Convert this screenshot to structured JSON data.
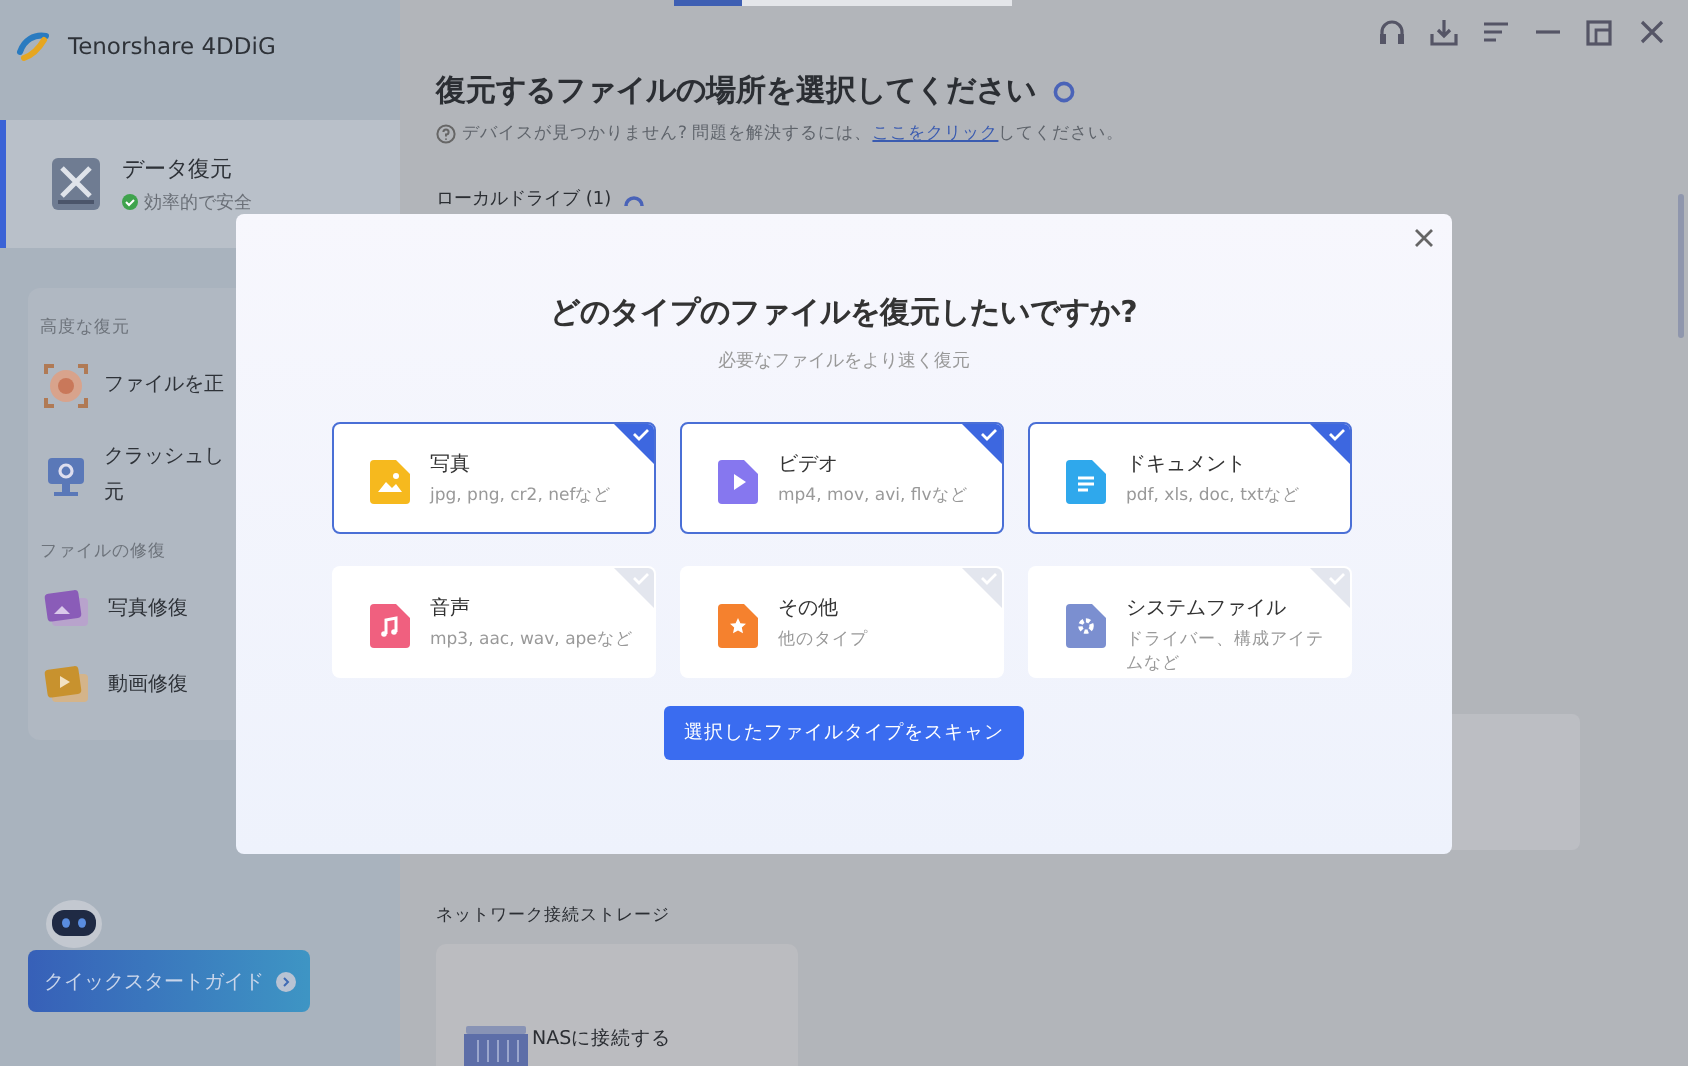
{
  "app": {
    "name": "Tenorshare 4DDiG"
  },
  "sidebar": {
    "main_item": {
      "title": "データ復元",
      "status": "効率的で安全",
      "selected": true
    },
    "sections": [
      {
        "heading": "高度な復元",
        "items": [
          {
            "kind": "target",
            "lines": [
              "ファイルを正"
            ]
          },
          {
            "kind": "monitor",
            "lines": [
              "クラッシュし",
              "元"
            ]
          }
        ]
      },
      {
        "heading": "ファイルの修復",
        "items": [
          {
            "kind": "photo",
            "lines": [
              "写真修復"
            ]
          },
          {
            "kind": "video",
            "lines": [
              "動画修復"
            ]
          }
        ]
      }
    ],
    "guide_button": "クイックスタートガイド"
  },
  "main": {
    "title": "復元するファイルの場所を選択してください",
    "help_text": "デバイスが見つかりません? 問題を解決するには、",
    "help_link": "ここをクリック",
    "help_after": "してください。",
    "local_heading": "ローカルドライブ (1)",
    "network_heading": "ネットワーク接続ストレージ",
    "nas_label": "NASに接続する"
  },
  "dialog": {
    "title": "どのタイプのファイルを復元したいですか?",
    "subtitle": "必要なファイルをより速く復元",
    "file_types": [
      {
        "kind": "photo",
        "name": "写真",
        "formats": "jpg, png, cr2, nefなど",
        "selected": true
      },
      {
        "kind": "video",
        "name": "ビデオ",
        "formats": "mp4, mov, avi, flvなど",
        "selected": true
      },
      {
        "kind": "document",
        "name": "ドキュメント",
        "formats": "pdf, xls, doc, txtなど",
        "selected": true
      },
      {
        "kind": "audio",
        "name": "音声",
        "formats": "mp3, aac, wav, apeなど",
        "selected": false
      },
      {
        "kind": "other",
        "name": "その他",
        "formats": "他のタイプ",
        "selected": false
      },
      {
        "kind": "system",
        "name": "システムファイル",
        "formats": "ドライバー、構成アイテムなど",
        "selected": false
      }
    ],
    "scan_button": "選択したファイルタイプをスキャン"
  }
}
